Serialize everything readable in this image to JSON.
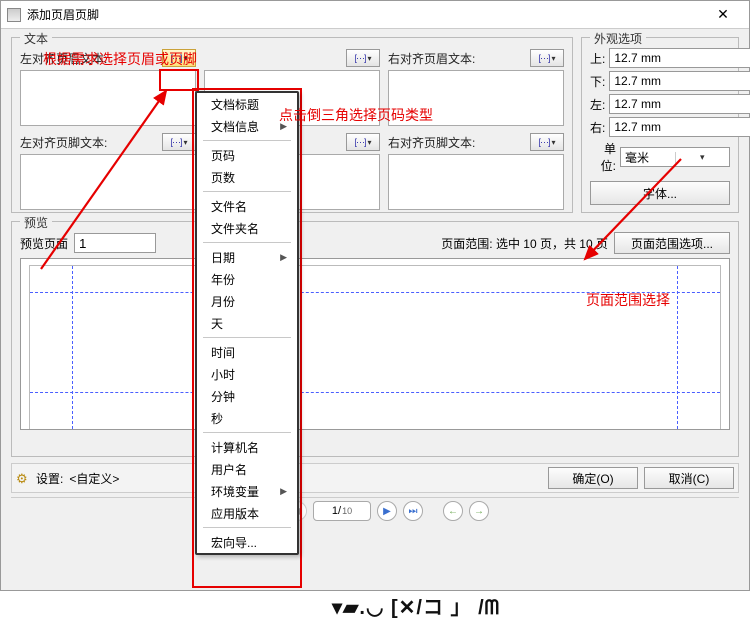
{
  "window": {
    "title": "添加页眉页脚"
  },
  "text_group": {
    "label": "文本",
    "cols": [
      {
        "header_label": "左对齐页眉文本:",
        "footer_label": "左对齐页脚文本:",
        "highlighted": true
      },
      {
        "header_label": "",
        "footer_label": ""
      },
      {
        "header_label": "右对齐页眉文本:",
        "footer_label": "右对齐页脚文本:"
      }
    ],
    "menu_btn_label": "[...] ▾"
  },
  "appearance": {
    "label": "外观选项",
    "top": {
      "lbl": "上:",
      "val": "12.7 mm"
    },
    "bottom": {
      "lbl": "下:",
      "val": "12.7 mm"
    },
    "left": {
      "lbl": "左:",
      "val": "12.7 mm"
    },
    "right": {
      "lbl": "右:",
      "val": "12.7 mm"
    },
    "unit": {
      "lbl": "单位:",
      "val": "毫米"
    },
    "font_btn": "字体..."
  },
  "preview": {
    "label": "预览",
    "page_lbl": "预览页面",
    "page_val": "1",
    "range_text": "页面范围: 选中 10 页，共 10 页",
    "range_btn": "页面范围选项..."
  },
  "bottom": {
    "settings_lbl": "设置:",
    "settings_val": "<自定义>",
    "ok": "确定(O)",
    "cancel": "取消(C)"
  },
  "pager": {
    "cur": "1",
    "total": "10"
  },
  "dropdown": {
    "groups": [
      [
        {
          "t": "文档标题",
          "sub": false
        },
        {
          "t": "文档信息",
          "sub": true
        }
      ],
      [
        {
          "t": "页码",
          "sub": false
        },
        {
          "t": "页数",
          "sub": false
        }
      ],
      [
        {
          "t": "文件名",
          "sub": false
        },
        {
          "t": "文件夹名",
          "sub": false
        }
      ],
      [
        {
          "t": "日期",
          "sub": true
        },
        {
          "t": "年份",
          "sub": false
        },
        {
          "t": "月份",
          "sub": false
        },
        {
          "t": "天",
          "sub": false
        }
      ],
      [
        {
          "t": "时间",
          "sub": false
        },
        {
          "t": "小时",
          "sub": false
        },
        {
          "t": "分钟",
          "sub": false
        },
        {
          "t": "秒",
          "sub": false
        }
      ],
      [
        {
          "t": "计算机名",
          "sub": false
        },
        {
          "t": "用户名",
          "sub": false
        },
        {
          "t": "环境变量",
          "sub": true
        },
        {
          "t": "应用版本",
          "sub": false
        }
      ],
      [
        {
          "t": "宏向导...",
          "sub": false
        }
      ]
    ]
  },
  "annotations": {
    "a1": "根据需求选择页眉或页脚",
    "a2": "点击倒三角选择页码类型",
    "a3": "页面范围选择"
  },
  "bg_text": "▾▰.◡  [✕/コ 」 /ᗰ"
}
